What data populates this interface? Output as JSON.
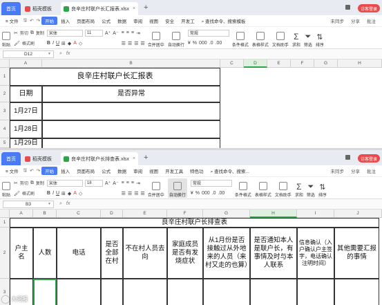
{
  "windows": [
    {
      "tabs": {
        "home": "首页",
        "daoke": "稻壳模板",
        "file": "良辛庄村联户长汇报表.xlsx"
      },
      "visitor": "访客登录",
      "menu": [
        "文件",
        "开始",
        "插入",
        "页面布局",
        "公式",
        "数据",
        "审阅",
        "视图",
        "安全",
        "开发工"
      ],
      "menu_start_index": 1,
      "search": "查找命令、搜索模板",
      "menu_right": [
        "未同步",
        "分享",
        "批注"
      ],
      "toolbar": {
        "paste": "粘贴",
        "cut": "剪切",
        "copy": "复制",
        "format_painter": "格式刷",
        "font": "宋体",
        "size": "11",
        "merge": "合并居中",
        "wrap": "自动换行",
        "numfmt": "常规",
        "cond": "条件格式",
        "table_style": "表格样式",
        "doc_helper": "文档助手",
        "sum": "求和",
        "filter": "筛选",
        "sort": "排序"
      },
      "namebox": "D12",
      "fx": "fx"
    },
    {
      "tabs": {
        "home": "首页",
        "daoke": "稻壳模板",
        "file": "良辛庄村联户长排查表.xlsx"
      },
      "visitor": "访客登录",
      "menu": [
        "文件",
        "开始",
        "插入",
        "页面布局",
        "公式",
        "数据",
        "审阅",
        "视图",
        "开发工具",
        "特色功"
      ],
      "menu_start_index": 1,
      "search": "查找命令、搜索...",
      "menu_right": [
        "未同步",
        "分享",
        "批注"
      ],
      "toolbar": {
        "paste": "粘贴",
        "cut": "剪切",
        "copy": "复制",
        "format_painter": "格式刷",
        "font": "宋体",
        "size": "18",
        "merge": "合并居中",
        "wrap": "自动换行",
        "numfmt": "常规",
        "cond": "条件格式",
        "table_style": "表格样式",
        "doc_helper": "文档助手",
        "sum": "求和",
        "filter": "筛选",
        "sort": "排序"
      },
      "namebox": "B3",
      "fx": "fx"
    }
  ],
  "sheet1": {
    "cols": [
      "A",
      "B",
      "C",
      "D",
      "E",
      "F",
      "G",
      "H"
    ],
    "rows": [
      "1",
      "2",
      "3",
      "4",
      "5"
    ],
    "title": "良辛庄村联户长汇报表",
    "header_date": "日期",
    "header_status": "是否异常",
    "dates": [
      "1月27日",
      "1月28日",
      "1月29日"
    ]
  },
  "sheet2": {
    "cols": [
      "A",
      "B",
      "C",
      "D",
      "E",
      "F",
      "G",
      "H",
      "I",
      "J"
    ],
    "rows": [
      "1",
      "2",
      "3"
    ],
    "title": "良辛庄村联户长排查表",
    "headers": [
      "户主名",
      "人数",
      "电话",
      "是否全部在村",
      "不在村人员去向",
      "家庭成员是否有发烧症状",
      "从1月份是否接触过从外地来的人员（来村又走的也算）",
      "是否通知本人是联户长，有事情及时与本人联系",
      "信息确认（入户确认户主签字，电话确认注明时间）",
      "其他需要汇报的事情"
    ]
  },
  "watermark": "大河报"
}
